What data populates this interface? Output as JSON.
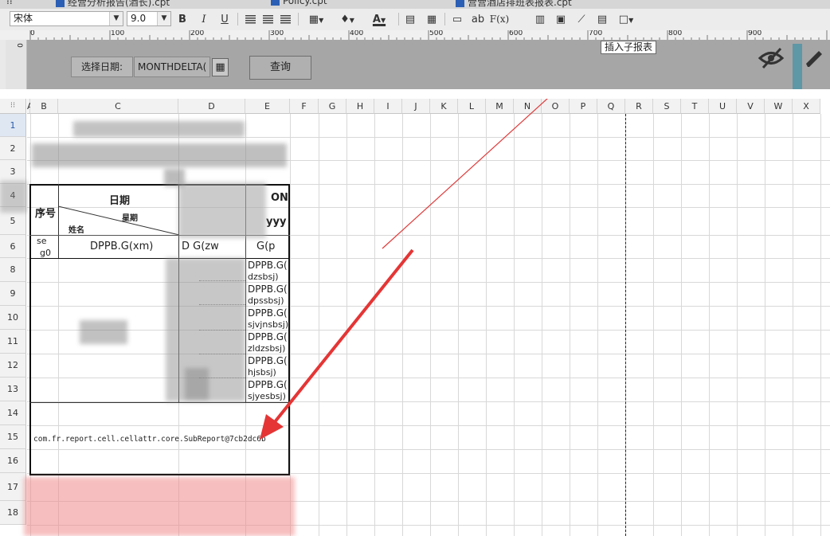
{
  "tabs": [
    {
      "label": "经营分析报告(酒长).cpt"
    },
    {
      "label": "Policy.cpt"
    },
    {
      "label": "营营酒店排班表报表.cpt"
    }
  ],
  "toolbar": {
    "font_name": "宋体",
    "font_size": "9.0",
    "bold": "B",
    "italic": "I",
    "underline": "U",
    "font_color": "A",
    "ab": "ab",
    "formula": "F(x)"
  },
  "ruler": {
    "marks": [
      "0",
      "100",
      "200",
      "300",
      "400",
      "500",
      "600",
      "700",
      "800",
      "900"
    ]
  },
  "vruler": {
    "mark": "0"
  },
  "param_pane": {
    "date_label": "选择日期:",
    "date_value": "MONTHDELTA(",
    "query_button": "查询"
  },
  "tooltip": {
    "text": "插入子报表"
  },
  "columns": [
    "A",
    "B",
    "C",
    "D",
    "E",
    "F",
    "G",
    "H",
    "I",
    "J",
    "K",
    "L",
    "M",
    "N",
    "O",
    "P",
    "Q",
    "R",
    "S",
    "T",
    "U",
    "V",
    "W",
    "X"
  ],
  "rows": [
    "1",
    "2",
    "3",
    "4",
    "5",
    "6",
    "8",
    "9",
    "10",
    "11",
    "12",
    "13",
    "14",
    "15",
    "16",
    "17",
    "18"
  ],
  "report": {
    "serial_header": "序号",
    "date_header": "日期",
    "weekday_header": "星期",
    "name_header": "姓名",
    "cut_header_top": "ON",
    "cut_header_bottom": "yyy",
    "r6_a": "se",
    "r6_a2": "g0",
    "r6_c": "DPPB.G(xm)",
    "r6_d": "D   G(zw",
    "r6_e": "G(p",
    "e_cells": [
      {
        "l1": "DPPB.G(",
        "l2": "dzsbsj)"
      },
      {
        "l1": "DPPB.G(",
        "l2": "dpssbsj)"
      },
      {
        "l1": "DPPB.G(",
        "l2": "sjvjnsbsj)"
      },
      {
        "l1": "DPPB.G(",
        "l2": "zldzsbsj)"
      },
      {
        "l1": "DPPB.G(",
        "l2": "hjsbsj)"
      },
      {
        "l1": "DPPB.G(",
        "l2": "sjyesbsj)"
      }
    ],
    "subreport_text": "com.fr.report.cell.cellattr.core.SubReport@7cb2dc6b"
  }
}
